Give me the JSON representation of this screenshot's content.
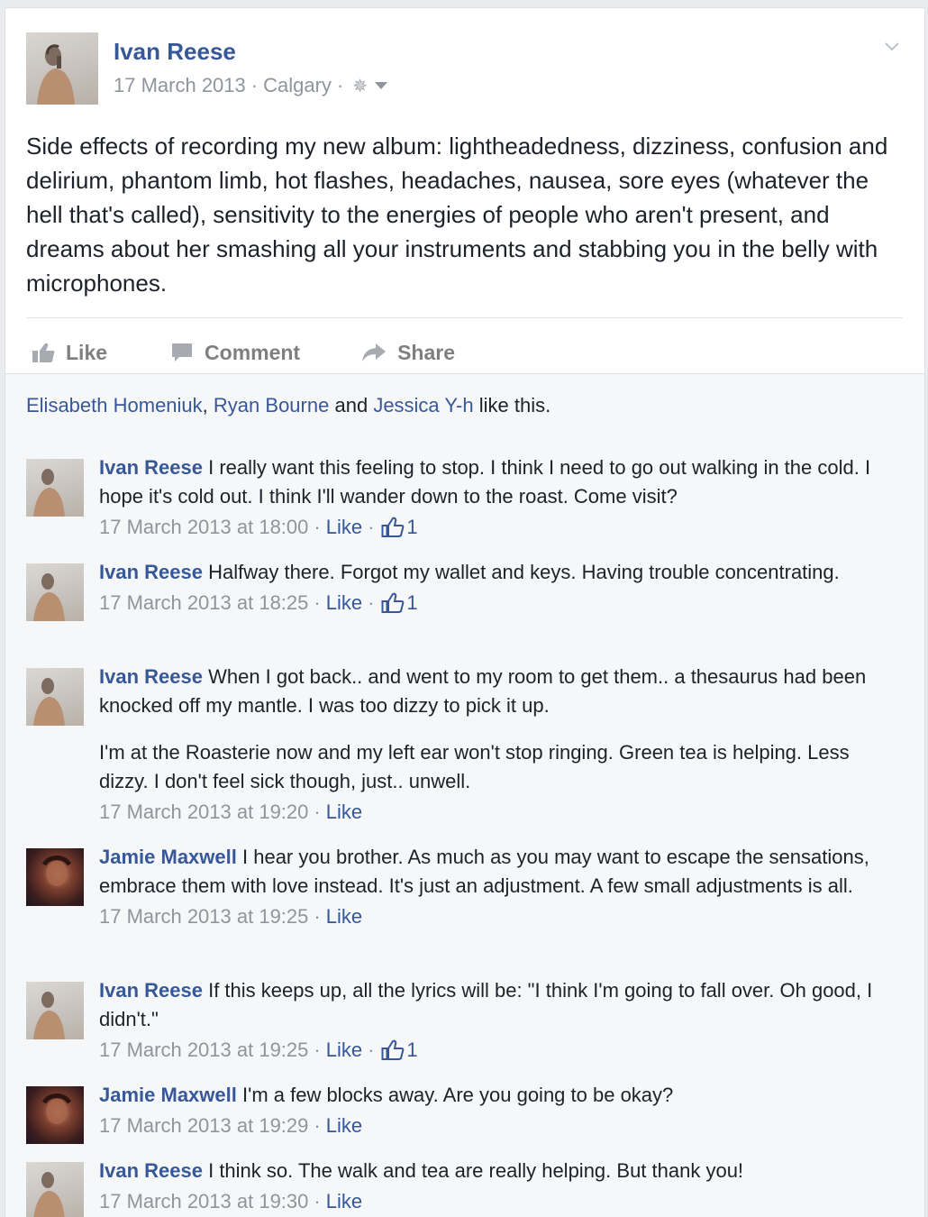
{
  "post": {
    "author": "Ivan Reese",
    "date": "17 March 2013",
    "location": "Calgary",
    "separator": "·",
    "privacy_icon": "gear-icon",
    "text": "Side effects of recording my new album: lightheadedness, dizziness, confusion and delirium, phantom limb, hot flashes, headaches, nausea, sore eyes (whatever the hell that's called), sensitivity to the energies of people who aren't present, and dreams about her smashing all your instruments and stabbing you in the belly with microphones."
  },
  "actions": {
    "like": "Like",
    "comment": "Comment",
    "share": "Share"
  },
  "likes": {
    "names": [
      "Elisabeth Homeniuk",
      "Ryan Bourne",
      "Jessica Y-h"
    ],
    "comma": ",",
    "and": "and",
    "suffix": "like this."
  },
  "comments": [
    {
      "author": "Ivan Reese",
      "text": "I really want this feeling to stop. I think I need to go out walking in the cold. I hope it's cold out. I think I'll wander down to the roast. Come visit?",
      "text2": "",
      "timestamp": "17 March 2013 at 18:00",
      "like_label": "Like",
      "like_count": "1"
    },
    {
      "author": "Ivan Reese",
      "text": "Halfway there. Forgot my wallet and keys. Having trouble concentrating.",
      "text2": "",
      "timestamp": "17 March 2013 at 18:25",
      "like_label": "Like",
      "like_count": "1"
    },
    {
      "author": "Ivan Reese",
      "text": "When I got back.. and went to my room to get them.. a thesaurus had been knocked off my mantle. I was too dizzy to pick it up.",
      "text2": "I'm at the Roasterie now and my left ear won't stop ringing. Green tea is helping. Less dizzy. I don't feel sick though, just.. unwell.",
      "timestamp": "17 March 2013 at 19:20",
      "like_label": "Like",
      "like_count": ""
    },
    {
      "author": "Jamie Maxwell",
      "text": "I hear you brother. As much as you may want to escape the sensations, embrace them with love instead. It's just an adjustment. A few small adjustments is all.",
      "text2": "",
      "timestamp": "17 March 2013 at 19:25",
      "like_label": "Like",
      "like_count": ""
    },
    {
      "author": "Ivan Reese",
      "text": "If this keeps up, all the lyrics will be: \"I think I'm going to fall over. Oh good, I didn't.\"",
      "text2": "",
      "timestamp": "17 March 2013 at 19:25",
      "like_label": "Like",
      "like_count": "1"
    },
    {
      "author": "Jamie Maxwell",
      "text": "I'm a few blocks away. Are you going to be okay?",
      "text2": "",
      "timestamp": "17 March 2013 at 19:29",
      "like_label": "Like",
      "like_count": ""
    },
    {
      "author": "Ivan Reese",
      "text": "I think so. The walk and tea are really helping. But thank you!",
      "text2": "",
      "timestamp": "17 March 2013 at 19:30",
      "like_label": "Like",
      "like_count": ""
    }
  ],
  "colors": {
    "link": "#365899",
    "meta": "#90949c",
    "text": "#1d2129",
    "feedback_bg": "#f6f7f9"
  }
}
